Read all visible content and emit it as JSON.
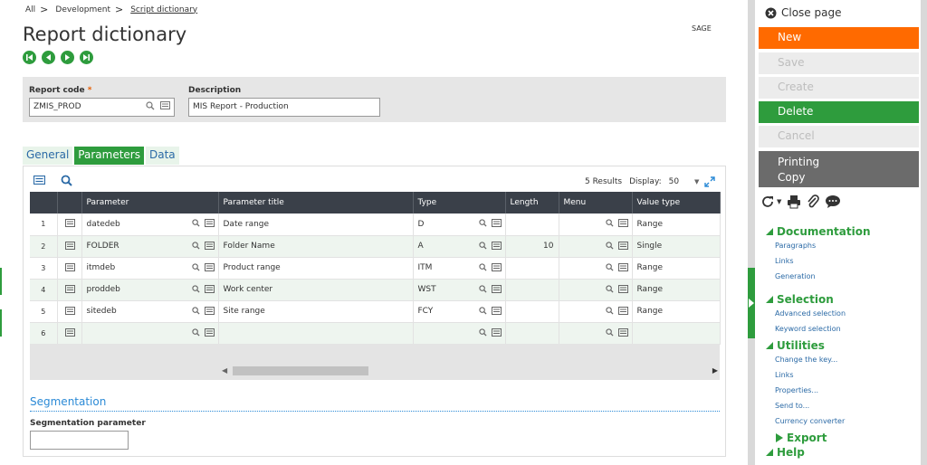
{
  "breadcrumb": {
    "all": "All",
    "development": "Development",
    "current": "Script dictionary"
  },
  "page_title": "Report dictionary",
  "folder_label": "SAGE",
  "key_panel": {
    "report_code_label": "Report code",
    "report_code_required": "*",
    "report_code_value": "ZMIS_PROD",
    "description_label": "Description",
    "description_value": "MIS Report - Production"
  },
  "tabs": [
    {
      "label": "General"
    },
    {
      "label": "Parameters"
    },
    {
      "label": "Data"
    }
  ],
  "grid": {
    "results": "5 Results",
    "display_label": "Display:",
    "display_value": "50",
    "columns": [
      "Parameter",
      "Parameter title",
      "Type",
      "Length",
      "Menu",
      "Value type"
    ],
    "rows": [
      {
        "num": "1",
        "parameter": "datedeb",
        "title": "Date range",
        "type": "D",
        "length": "",
        "menu": "",
        "value_type": "Range"
      },
      {
        "num": "2",
        "parameter": "FOLDER",
        "title": "Folder Name",
        "type": "A",
        "length": "10",
        "menu": "",
        "value_type": "Single"
      },
      {
        "num": "3",
        "parameter": "itmdeb",
        "title": "Product range",
        "type": "ITM",
        "length": "",
        "menu": "",
        "value_type": "Range"
      },
      {
        "num": "4",
        "parameter": "proddeb",
        "title": "Work center",
        "type": "WST",
        "length": "",
        "menu": "",
        "value_type": "Range"
      },
      {
        "num": "5",
        "parameter": "sitedeb",
        "title": "Site range",
        "type": "FCY",
        "length": "",
        "menu": "",
        "value_type": "Range"
      },
      {
        "num": "6",
        "parameter": "",
        "title": "",
        "type": "",
        "length": "",
        "menu": "",
        "value_type": ""
      }
    ]
  },
  "segmentation": {
    "title": "Segmentation",
    "param_label": "Segmentation parameter",
    "param_value": ""
  },
  "right_panel": {
    "close_page": "Close page",
    "buttons": {
      "new": "New",
      "save": "Save",
      "create": "Create",
      "delete": "Delete",
      "cancel": "Cancel",
      "printing": "Printing",
      "copy": "Copy"
    },
    "sections": {
      "documentation": {
        "title": "Documentation",
        "links": [
          "Paragraphs",
          "Links",
          "Generation"
        ]
      },
      "selection": {
        "title": "Selection",
        "links": [
          "Advanced selection",
          "Keyword selection"
        ]
      },
      "utilities": {
        "title": "Utilities",
        "links": [
          "Change the key...",
          "Links",
          "Properties...",
          "Send to...",
          "Currency converter"
        ]
      },
      "export": {
        "title": "Export"
      },
      "help": {
        "title": "Help"
      }
    }
  },
  "colors": {
    "accent_green": "#2e9c3d",
    "new_orange": "#ff6a00",
    "header_dark": "#3a4049",
    "link_blue": "#2b6aa6"
  }
}
